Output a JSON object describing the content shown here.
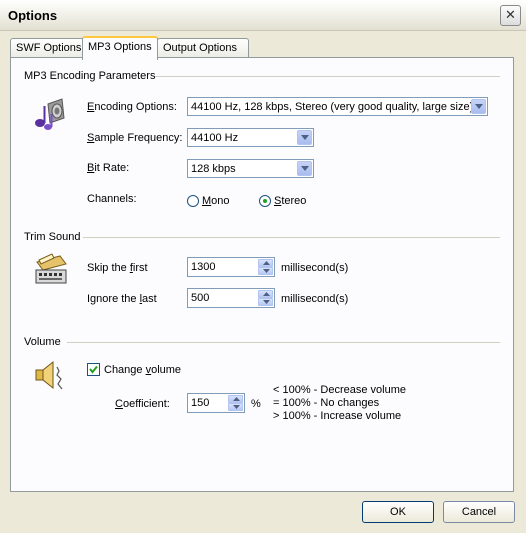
{
  "window": {
    "title": "Options",
    "close_glyph": "✕"
  },
  "tabs": [
    {
      "label": "SWF Options",
      "active": false
    },
    {
      "label": "MP3 Options",
      "active": true
    },
    {
      "label": "Output Options",
      "active": false
    }
  ],
  "encoding": {
    "group_title": "MP3 Encoding Parameters",
    "icon": "music-notes-speaker-icon",
    "options_label_u": "E",
    "options_label_rest": "ncoding Options:",
    "options_value": "44100 Hz, 128 kbps, Stereo (very good quality, large size)",
    "freq_label_u": "S",
    "freq_label_rest": "ample Frequency:",
    "freq_value": "44100 Hz",
    "bitrate_label_u": "B",
    "bitrate_label_rest": "it Rate:",
    "bitrate_value": "128 kbps",
    "channels_label": "Channels:",
    "mono_u": "M",
    "mono_rest": "ono",
    "stereo_u": "S",
    "stereo_rest": "tereo",
    "selected_channel": "Stereo"
  },
  "trim": {
    "group_title": "Trim Sound",
    "icon": "tape-recorder-icon",
    "skip_label_pre": "Skip the ",
    "skip_label_u": "f",
    "skip_label_post": "irst",
    "skip_value": "1300",
    "skip_unit": "millisecond(s)",
    "ignore_label_pre": "Ignore the ",
    "ignore_label_u": "l",
    "ignore_label_post": "ast",
    "ignore_value": "500",
    "ignore_unit": "millisecond(s)"
  },
  "volume": {
    "group_title": "Volume",
    "icon": "speaker-volume-icon",
    "change_pre": "Change ",
    "change_u": "v",
    "change_post": "olume",
    "change_checked": true,
    "coef_label_u": "C",
    "coef_label_rest": "oefficient:",
    "coef_value": "150",
    "coef_unit": "%",
    "legend": [
      "< 100% - Decrease volume",
      "= 100% - No changes",
      "> 100% - Increase volume"
    ]
  },
  "buttons": {
    "ok": "OK",
    "cancel": "Cancel"
  },
  "colors": {
    "accent_tab": "#ffc83c",
    "check_green": "#21a121"
  }
}
